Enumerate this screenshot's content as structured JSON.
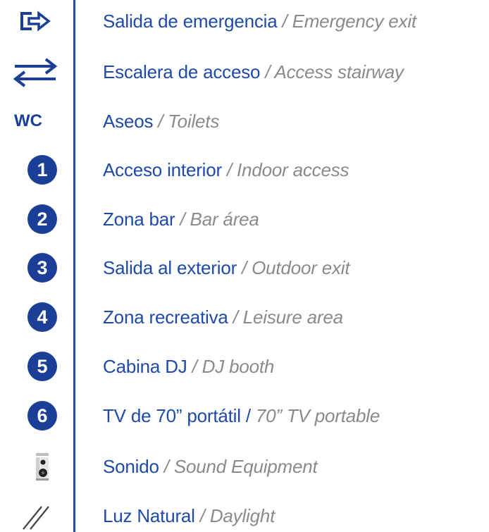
{
  "legend": [
    {
      "icon": "exit-arrow-icon",
      "es": "Salida de emergencia",
      "sep": " / ",
      "en": "Emergency exit"
    },
    {
      "icon": "bidirectional-arrows-icon",
      "es": "Escalera de acceso",
      "sep": " / ",
      "en": "Access stairway"
    },
    {
      "icon": "wc-icon",
      "icon_text": "WC",
      "es": "Aseos",
      "sep": " / ",
      "en": "Toilets"
    },
    {
      "icon": "number-badge-icon",
      "icon_text": "1",
      "es": "Acceso interior",
      "sep": " / ",
      "en": "Indoor access"
    },
    {
      "icon": "number-badge-icon",
      "icon_text": "2",
      "es": "Zona bar",
      "sep": " / ",
      "en": "Bar área"
    },
    {
      "icon": "number-badge-icon",
      "icon_text": "3",
      "es": "Salida al exterior",
      "sep": " / ",
      "en": "Outdoor exit"
    },
    {
      "icon": "number-badge-icon",
      "icon_text": "4",
      "es": "Zona recreativa",
      "sep": " / ",
      "en": "Leisure area"
    },
    {
      "icon": "number-badge-icon",
      "icon_text": "5",
      "es": "Cabina DJ",
      "sep": " / ",
      "en": "DJ booth"
    },
    {
      "icon": "number-badge-icon",
      "icon_text": "6",
      "es": "TV de 70” portátil",
      "sep": " / ",
      "en": "70” TV portable"
    },
    {
      "icon": "speaker-icon",
      "es": "Sonido",
      "sep": " / ",
      "en": "Sound Equipment"
    },
    {
      "icon": "window-lines-icon",
      "es": "Luz Natural",
      "sep": " / ",
      "en": "Daylight"
    }
  ],
  "colors": {
    "primary": "#1b3f97",
    "label": "#1f4aa8",
    "secondary": "#8a8a8a"
  }
}
